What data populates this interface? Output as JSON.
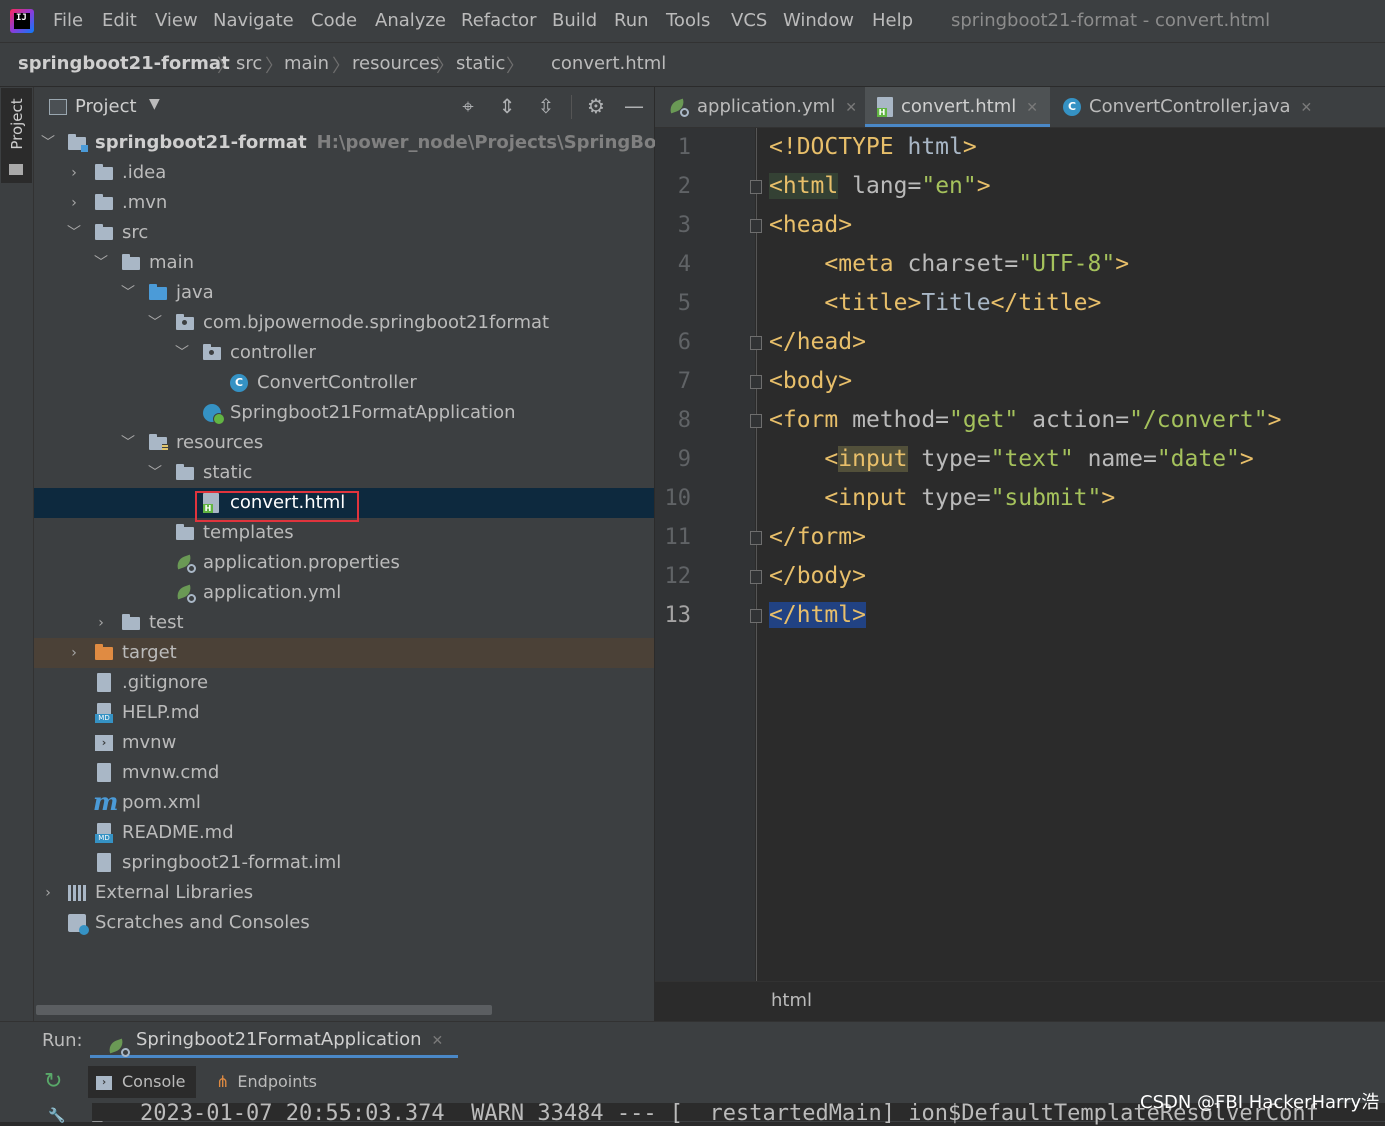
{
  "menu": {
    "logo_text": "IJ",
    "items": [
      "File",
      "Edit",
      "View",
      "Navigate",
      "Code",
      "Analyze",
      "Refactor",
      "Build",
      "Run",
      "Tools",
      "VCS",
      "Window",
      "Help"
    ],
    "window_title": "springboot21-format - convert.html"
  },
  "breadcrumb": [
    "springboot21-format",
    "src",
    "main",
    "resources",
    "static",
    "convert.html"
  ],
  "left_stripe": {
    "project_label": "Project"
  },
  "project_panel": {
    "title": "Project",
    "dropdown": "▼",
    "tree": [
      {
        "label": "springboot21-format",
        "path": "H:\\power_node\\Projects\\SpringBootProje"
      },
      {
        "label": ".idea"
      },
      {
        "label": ".mvn"
      },
      {
        "label": "src"
      },
      {
        "label": "main"
      },
      {
        "label": "java"
      },
      {
        "label": "com.bjpowernode.springboot21format"
      },
      {
        "label": "controller"
      },
      {
        "label": "ConvertController"
      },
      {
        "label": "Springboot21FormatApplication"
      },
      {
        "label": "resources"
      },
      {
        "label": "static"
      },
      {
        "label": "convert.html"
      },
      {
        "label": "templates"
      },
      {
        "label": "application.properties"
      },
      {
        "label": "application.yml"
      },
      {
        "label": "test"
      },
      {
        "label": "target"
      },
      {
        "label": ".gitignore"
      },
      {
        "label": "HELP.md"
      },
      {
        "label": "mvnw"
      },
      {
        "label": "mvnw.cmd"
      },
      {
        "label": "pom.xml"
      },
      {
        "label": "README.md"
      },
      {
        "label": "springboot21-format.iml"
      },
      {
        "label": "External Libraries"
      },
      {
        "label": "Scratches and Consoles"
      }
    ]
  },
  "editor": {
    "tabs": [
      {
        "label": "application.yml"
      },
      {
        "label": "convert.html"
      },
      {
        "label": "ConvertController.java"
      }
    ],
    "line_numbers": [
      "1",
      "2",
      "3",
      "4",
      "5",
      "6",
      "7",
      "8",
      "9",
      "10",
      "11",
      "12",
      "13"
    ],
    "current_line": "13",
    "crumb": "html"
  },
  "run_panel": {
    "label": "Run:",
    "config": "Springboot21FormatApplication",
    "tabs": [
      "Console",
      "Endpoints"
    ],
    "console_line": "2023-01-07 20:55:03.374  WARN 33484 --- [  restartedMain] ion$DefaultTemplateResolverConf"
  },
  "watermark": "CSDN @FBI HackerHarry浩",
  "colors": {
    "accent": "#4a88c7",
    "selection": "#0d293e",
    "highlight_box": "#e0343d",
    "tag": "#e8bf6a",
    "string": "#a5c25c"
  }
}
